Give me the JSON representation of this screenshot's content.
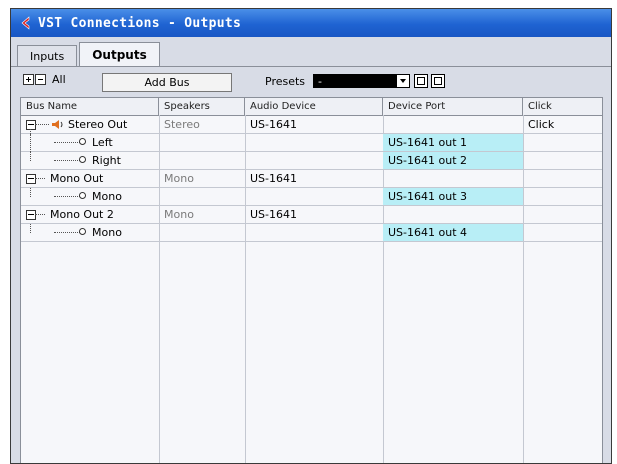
{
  "window": {
    "title": "VST Connections - Outputs"
  },
  "tabs": [
    {
      "label": "Inputs"
    },
    {
      "label": "Outputs"
    }
  ],
  "toolbar": {
    "all_label": "All",
    "add_bus_label": "Add Bus",
    "presets_label": "Presets",
    "presets_value": "-"
  },
  "table": {
    "columns": [
      {
        "label": "Bus Name"
      },
      {
        "label": "Speakers"
      },
      {
        "label": "Audio Device"
      },
      {
        "label": "Device Port"
      },
      {
        "label": "Click"
      }
    ],
    "rows": [
      {
        "name": "Stereo Out",
        "speakers": "Stereo",
        "device": "US-1641",
        "port": "",
        "click": "Click"
      },
      {
        "name": "Left",
        "speakers": "",
        "device": "",
        "port": "US-1641 out 1",
        "click": ""
      },
      {
        "name": "Right",
        "speakers": "",
        "device": "",
        "port": "US-1641 out 2",
        "click": ""
      },
      {
        "name": "Mono Out",
        "speakers": "Mono",
        "device": "US-1641",
        "port": "",
        "click": ""
      },
      {
        "name": "Mono",
        "speakers": "",
        "device": "",
        "port": "US-1641 out 3",
        "click": ""
      },
      {
        "name": "Mono Out 2",
        "speakers": "Mono",
        "device": "US-1641",
        "port": "",
        "click": ""
      },
      {
        "name": "Mono",
        "speakers": "",
        "device": "",
        "port": "US-1641 out 4",
        "click": ""
      }
    ]
  },
  "colors": {
    "titlebar": "#1f63d2",
    "port_highlight": "#b8eef6",
    "logo": "#d81e1e"
  }
}
